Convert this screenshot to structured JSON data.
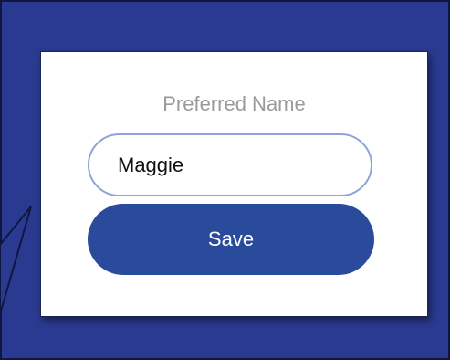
{
  "form": {
    "label": "Preferred Name",
    "name_value": "Maggie",
    "save_label": "Save"
  },
  "colors": {
    "background": "#2b3a91",
    "card": "#ffffff",
    "button": "#2a4a9c",
    "input_border": "#8ea4d8",
    "label_text": "#9a9a9a"
  }
}
